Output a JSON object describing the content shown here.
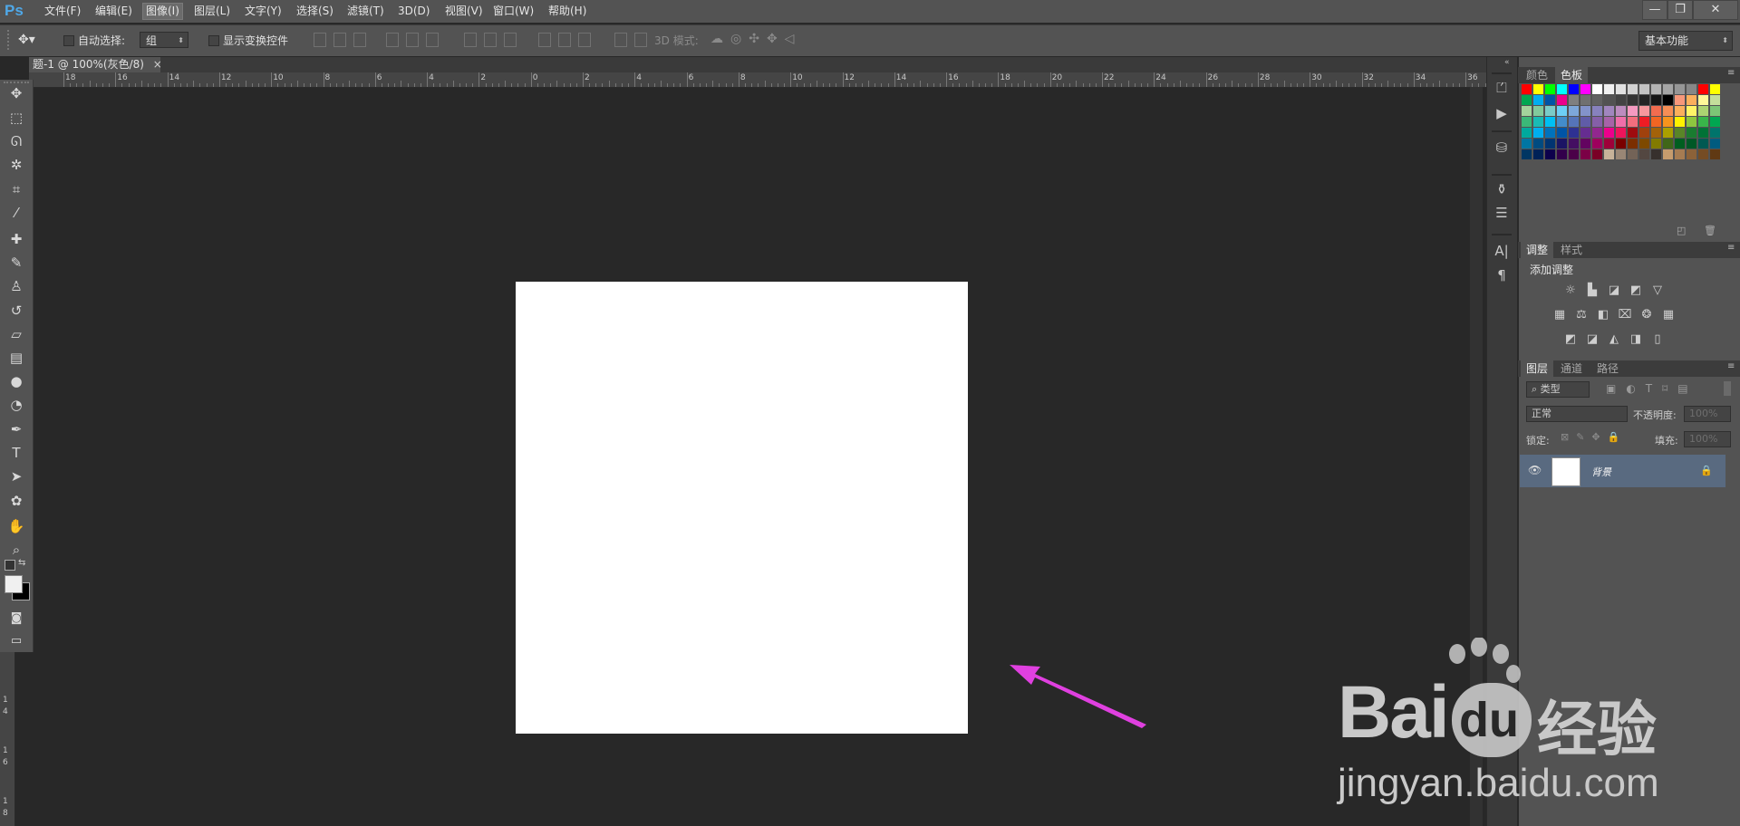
{
  "app": {
    "logo": "Ps"
  },
  "menu": [
    "文件(F)",
    "编辑(E)",
    "图像(I)",
    "图层(L)",
    "文字(Y)",
    "选择(S)",
    "滤镜(T)",
    "3D(D)",
    "视图(V)",
    "窗口(W)",
    "帮助(H)"
  ],
  "menu_active_index": 2,
  "window_controls": {
    "minimize": "—",
    "restore": "❐",
    "close": "✕"
  },
  "options": {
    "auto_select_label": "自动选择:",
    "auto_select_value": "组",
    "transform_label": "显示变换控件",
    "mode3d_label": "3D 模式:",
    "workspace": "基本功能"
  },
  "document": {
    "tab_title": "题-1 @ 100%(灰色/8)",
    "close_glyph": "×"
  },
  "ruler": {
    "h_labels": [
      "18",
      "16",
      "14",
      "12",
      "10",
      "8",
      "6",
      "4",
      "2",
      "0",
      "2",
      "4",
      "6",
      "8",
      "10",
      "12",
      "14",
      "16",
      "18",
      "20",
      "22",
      "24",
      "26",
      "28",
      "30",
      "32",
      "34",
      "36"
    ],
    "v_labels": [
      "1",
      "4",
      "1",
      "6",
      "1",
      "8",
      "2"
    ]
  },
  "tools": [
    "move-icon",
    "marquee-icon",
    "lasso-icon",
    "magic-wand-icon",
    "crop-icon",
    "eyedropper-icon",
    "healing-icon",
    "brush-icon",
    "stamp-icon",
    "history-brush-icon",
    "eraser-icon",
    "gradient-icon",
    "blur-icon",
    "dodge-icon",
    "pen-icon",
    "type-icon",
    "path-select-icon",
    "shape-icon",
    "hand-icon",
    "zoom-icon"
  ],
  "swatches_panel": {
    "tabs": [
      "颜色",
      "色板"
    ],
    "active_tab": 1,
    "colors": [
      "#ff0000",
      "#ffff00",
      "#00ff00",
      "#00ffff",
      "#0000ff",
      "#ff00ff",
      "#ffffff",
      "#f0f0f0",
      "#e1e1e1",
      "#d2d2d2",
      "#c3c3c3",
      "#b4b4b4",
      "#a5a5a5",
      "#969696",
      "#878787",
      "#ff0000",
      "#ffff00",
      "#00a651",
      "#00aeef",
      "#0054a6",
      "#ec008c",
      "#7f7f7f",
      "#707070",
      "#616161",
      "#525252",
      "#434343",
      "#343434",
      "#252525",
      "#161616",
      "#000000",
      "#f7977a",
      "#fbaf5d",
      "#fff799",
      "#c4df9b",
      "#a3d39c",
      "#82ca9c",
      "#7accc8",
      "#6dcff6",
      "#7da7d9",
      "#8393ca",
      "#8781bd",
      "#a186be",
      "#bd8cbf",
      "#f49ac1",
      "#f6989d",
      "#f26c4f",
      "#f68e55",
      "#fbaf5c",
      "#fff467",
      "#acd372",
      "#7cc576",
      "#3bb878",
      "#1abbb4",
      "#00bff3",
      "#438cca",
      "#5574b9",
      "#605ca8",
      "#855fa8",
      "#a763a8",
      "#f06ea9",
      "#f26d7d",
      "#ed1c24",
      "#f26522",
      "#f7941d",
      "#fff200",
      "#8dc63f",
      "#39b54a",
      "#00a651",
      "#00a99d",
      "#00aeef",
      "#0072bc",
      "#0054a6",
      "#2e3192",
      "#662d91",
      "#92278f",
      "#ec008c",
      "#ed145b",
      "#9e0b0f",
      "#a0410d",
      "#a36209",
      "#aba000",
      "#598527",
      "#1a7b30",
      "#007236",
      "#00746b",
      "#0076a3",
      "#004b80",
      "#003471",
      "#1b1464",
      "#440e62",
      "#630460",
      "#9e005d",
      "#9e0039",
      "#790000",
      "#7b2e00",
      "#7d4900",
      "#827b00",
      "#406618",
      "#005e20",
      "#005826",
      "#005952",
      "#005b7f",
      "#003663",
      "#002157",
      "#0d004c",
      "#32004b",
      "#4b0049",
      "#7b0046",
      "#7a0026",
      "#c7b299",
      "#998675",
      "#736357",
      "#534741",
      "#37302d",
      "#c69c6d",
      "#a67c52",
      "#8c6239",
      "#754c24",
      "#603913"
    ]
  },
  "adjust_panel": {
    "tabs": [
      "调整",
      "样式"
    ],
    "active_tab": 0,
    "title": "添加调整",
    "row1": [
      "brightness-icon",
      "levels-icon",
      "curves-icon",
      "exposure-icon",
      "vibrance-icon"
    ],
    "row2": [
      "hue-icon",
      "color-balance-icon",
      "bw-icon",
      "photo-filter-icon",
      "channel-mixer-icon",
      "color-lookup-icon"
    ],
    "row3": [
      "invert-icon",
      "posterize-icon",
      "threshold-icon",
      "selective-color-icon",
      "gradient-map-icon"
    ]
  },
  "layers_panel": {
    "tabs": [
      "图层",
      "通道",
      "路径"
    ],
    "active_tab": 0,
    "filter_label": "类型",
    "blend_mode": "正常",
    "opacity_label": "不透明度:",
    "opacity_value": "100%",
    "lock_label": "锁定:",
    "fill_label": "填充:",
    "fill_value": "100%",
    "layers": [
      {
        "name": "背景",
        "visible": true,
        "locked": true
      }
    ]
  },
  "watermark": {
    "brand": "Bai",
    "brand_tail": "du",
    "cn": "经验",
    "url": "jingyan.baidu.com"
  },
  "colors": {
    "arrow": "#e040e0",
    "accent": "#4fa8e8",
    "layer_selected": "#596a80"
  }
}
